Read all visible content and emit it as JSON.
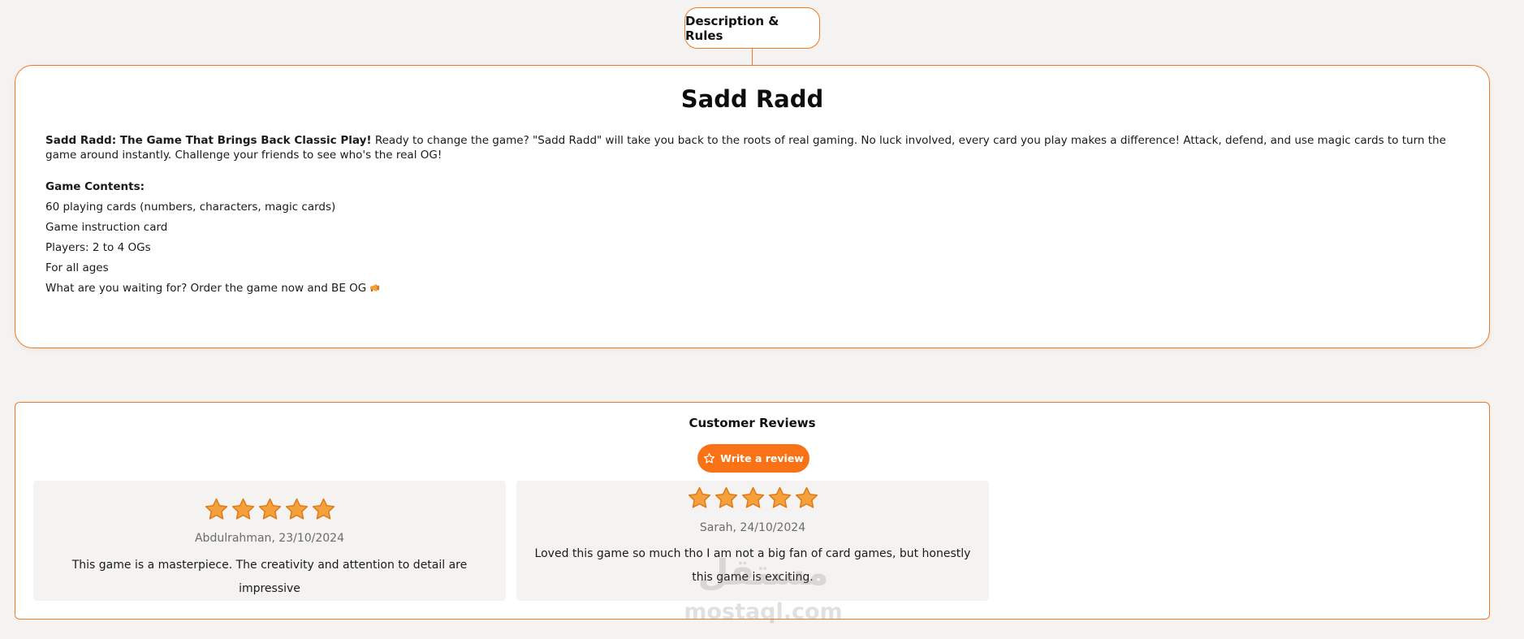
{
  "tab": {
    "label": "Description & Rules"
  },
  "description": {
    "title": "Sadd Radd",
    "intro_bold": "Sadd Radd: The Game That Brings Back Classic Play!",
    "intro_text": " Ready to change the game? \"Sadd Radd\" will take you back to the roots of real gaming. No luck involved, every card you play makes a difference! Attack, defend, and use magic cards to turn the game around instantly. Challenge your friends to see who's the real OG!",
    "contents_heading": "Game Contents:",
    "contents": [
      "60 playing cards (numbers, characters, magic cards)",
      "Game instruction card",
      "Players: 2 to 4 OGs",
      "For all ages",
      "What are you waiting for? Order the game now and BE OG"
    ],
    "emoji_icon": "megaphone-icon"
  },
  "reviews": {
    "title": "Customer Reviews",
    "write_button": "Write a review",
    "items": [
      {
        "rating": 5,
        "author": "Abdulrahman, 23/10/2024",
        "text": "This game is a masterpiece. The creativity and attention to detail are impressive"
      },
      {
        "rating": 5,
        "author": "Sarah, 24/10/2024",
        "text": "Loved this game so much tho I am not a big fan of card games, but honestly this game is exciting."
      }
    ]
  },
  "watermark": {
    "arabic": "مستقل",
    "latin": "mostaql.com"
  },
  "colors": {
    "accent": "#f07a22",
    "button": "#f97316",
    "star_fill": "#f5a13b",
    "star_stroke": "#e07a1a",
    "background": "#f4f3f1"
  }
}
